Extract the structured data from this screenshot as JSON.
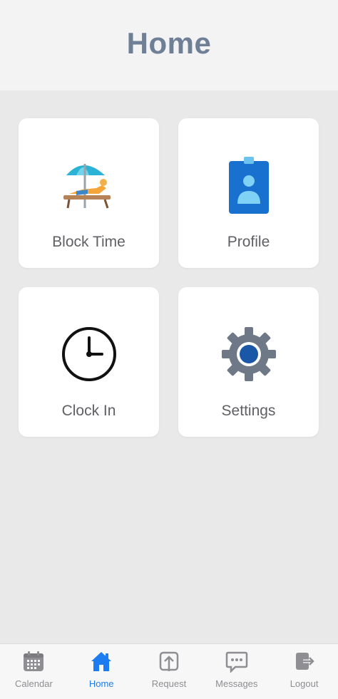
{
  "header": {
    "title": "Home"
  },
  "tiles": [
    {
      "label": "Block Time",
      "icon": "beach-lounger-icon"
    },
    {
      "label": "Profile",
      "icon": "id-badge-icon"
    },
    {
      "label": "Clock In",
      "icon": "clock-icon"
    },
    {
      "label": "Settings",
      "icon": "gear-icon"
    }
  ],
  "tabbar": {
    "active": "Home",
    "items": [
      {
        "label": "Calendar",
        "icon": "calendar-icon"
      },
      {
        "label": "Home",
        "icon": "home-icon"
      },
      {
        "label": "Request",
        "icon": "upload-request-icon"
      },
      {
        "label": "Messages",
        "icon": "message-bubble-icon"
      },
      {
        "label": "Logout",
        "icon": "logout-icon"
      }
    ]
  },
  "colors": {
    "title": "#6e7f96",
    "active_tab": "#1d7cf0",
    "inactive_tab": "#8e8e93",
    "background": "#e9e9e9"
  }
}
